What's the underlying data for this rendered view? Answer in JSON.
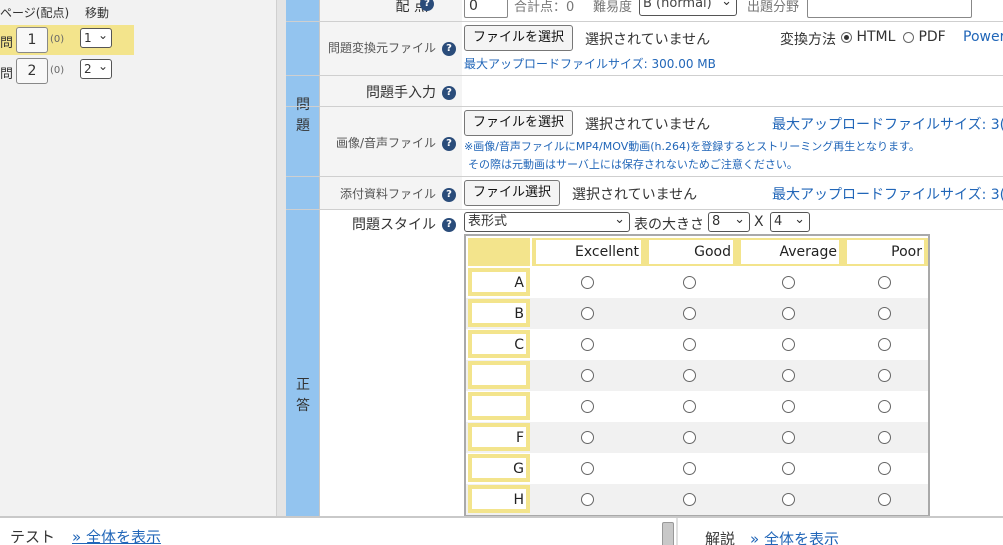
{
  "left_panel": {
    "header": {
      "page_points": "ページ(配点)",
      "move": "移動"
    },
    "questions": [
      {
        "prefix": "問",
        "number": "1",
        "points": "(0)",
        "move": "1",
        "active": true
      },
      {
        "prefix": "問",
        "number": "2",
        "points": "(0)",
        "move": "2",
        "active": false
      }
    ]
  },
  "main": {
    "top_row": {
      "label": "配 点",
      "points_value": "0",
      "total_points": "合計点：0",
      "difficulty_label": "難易度",
      "difficulty_value": "B (normal)",
      "field_label": "出題分野",
      "field_value": ""
    },
    "problem_section": {
      "side_label_1": "問",
      "side_label_2": "題",
      "convert_file": {
        "label": "問題変換元ファイル",
        "button": "ファイルを選択",
        "status": "選択されていません",
        "method_label": "変換方法",
        "option_html": "HTML",
        "option_pdf": "PDF",
        "selected": "HTML",
        "power_link": "Power",
        "max_size": "最大アップロードファイルサイズ: 300.00 MB"
      },
      "manual_input": {
        "label": "問題手入力"
      },
      "media_file": {
        "label": "画像/音声ファイル",
        "button": "ファイルを選択",
        "status": "選択されていません",
        "max_size": "最大アップロードファイルサイズ: 3(",
        "note_1": "※画像/音声ファイルにMP4/MOV動画(h.264)を登録するとストリーミング再生となります。",
        "note_2": "その際は元動画はサーバ上には保存されないためご注意ください。"
      },
      "attachment_file": {
        "label": "添付資料ファイル",
        "button": "ファイル選択",
        "status": "選択されていません",
        "max_size": "最大アップロードファイルサイズ: 3("
      }
    },
    "answer_section": {
      "side_label_1": "正",
      "side_label_2": "答",
      "style_label": "問題スタイル",
      "style_value": "表形式",
      "table_size_label": "表の大きさ",
      "rows_value": "8",
      "times": "X",
      "cols_value": "4",
      "grid": {
        "columns": [
          "Excellent",
          "Good",
          "Average",
          "Poor"
        ],
        "rows": [
          "A",
          "B",
          "C",
          "",
          "",
          "F",
          "G",
          "H"
        ]
      }
    }
  },
  "bottom": {
    "test_label": "テスト",
    "test_link": "» 全体を表示",
    "explain_label": "解説",
    "explain_link": "» 全体を表示"
  }
}
